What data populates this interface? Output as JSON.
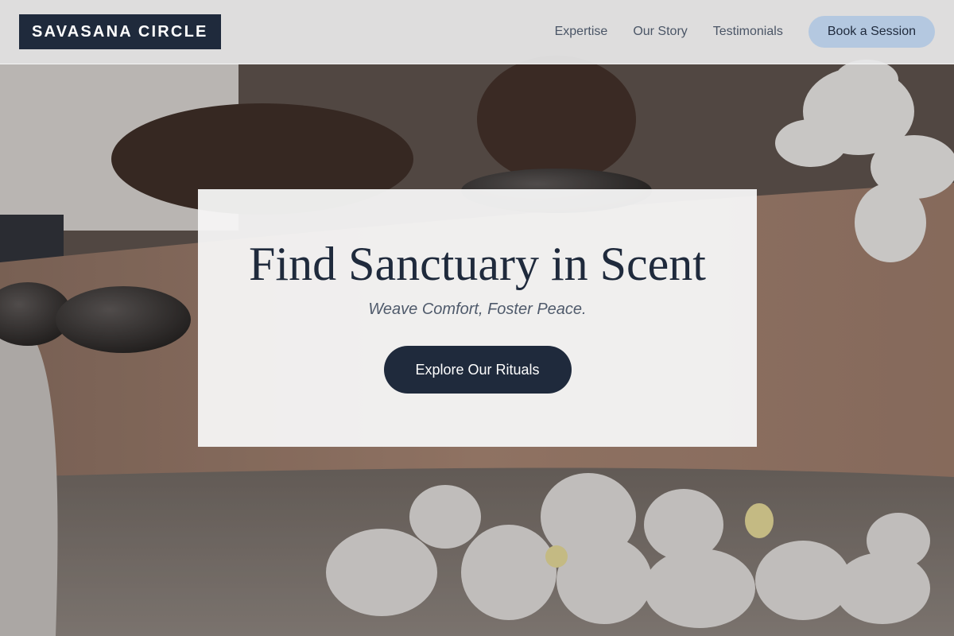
{
  "brand": {
    "name": "SAVASANA CIRCLE"
  },
  "nav": {
    "links": [
      "Expertise",
      "Our Story",
      "Testimonials"
    ],
    "cta_label": "Book a Session"
  },
  "hero": {
    "title": "Find Sanctuary in Scent",
    "subtitle": "Weave Comfort, Foster Peace.",
    "cta_label": "Explore Our Rituals",
    "background_image": "hot-stone-massage-with-white-orchids"
  },
  "colors": {
    "navy": "#1f2a3c",
    "accent_button": "#b4c8e0",
    "nav_text": "#4a5566",
    "card_bg": "#f6f5f6"
  }
}
